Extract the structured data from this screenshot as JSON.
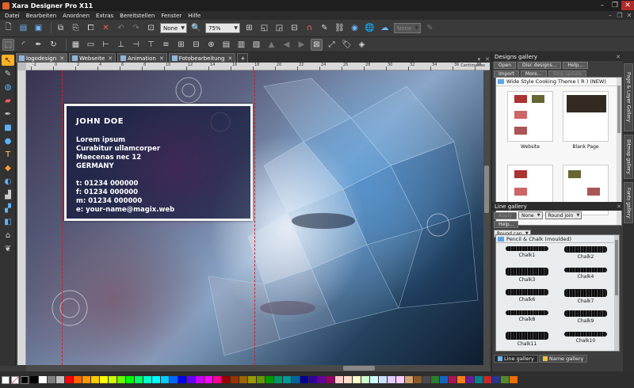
{
  "app": {
    "title": "Xara Designer Pro X11"
  },
  "window_controls": {
    "minimize": "–",
    "restore": "❐",
    "close": "✕"
  },
  "menu": [
    "Datei",
    "Bearbeiten",
    "Anordnen",
    "Extras",
    "Bereitstellen",
    "Fenster",
    "Hilfe"
  ],
  "doc_controls": [
    "–",
    "❐",
    "✕"
  ],
  "toolbar": {
    "line_width_value": "None",
    "zoom_value": "75%",
    "blend_value": "None"
  },
  "doc_tabs": [
    {
      "label": "logodesign",
      "active": true
    },
    {
      "label": "Webseite",
      "active": false
    },
    {
      "label": "Animation",
      "active": false
    },
    {
      "label": "Fotobearbeitung",
      "active": false
    }
  ],
  "ruler": {
    "units": "Centimetres",
    "labels": [
      "-2",
      "0",
      "2",
      "4",
      "6",
      "8",
      "10",
      "12",
      "14",
      "16",
      "18",
      "20",
      "22",
      "24",
      "26",
      "28",
      "30",
      "32",
      "34",
      "36",
      "38"
    ]
  },
  "business_card": {
    "name": "JOHN DOE",
    "address": [
      "Lorem ipsum",
      "Curabitur ullamcorper",
      "Maecenas nec 12",
      "GERMANY"
    ],
    "contacts": [
      "t: 01234 000000",
      "f: 01234 000000",
      "m: 01234 000000",
      "e: your-name@magix.web"
    ]
  },
  "designs_gallery": {
    "title": "Designs gallery",
    "buttons_row1": [
      "Open",
      "Disc designs...",
      "Help..."
    ],
    "buttons_row2": [
      "Import",
      "More...",
      "Stop update"
    ],
    "folder": "Wide Style Cooking Theme ( R ) (NEW)",
    "items": [
      "Website",
      "Blank Page"
    ]
  },
  "line_gallery": {
    "title": "Line gallery",
    "apply_label": "Apply",
    "help_label": "Help...",
    "dash_value": "None",
    "join_value": "Round join",
    "cap_value": "Round cap",
    "folder": "Pencil & Chalk (moulded)",
    "items": [
      "Chalk1",
      "Chalk2",
      "Chalk3",
      "Chalk4",
      "Chalk6",
      "Chalk7",
      "Chalk8",
      "Chalk9",
      "Chalk11",
      "Chalk10"
    ]
  },
  "gallery_tabs": [
    "Line gallery",
    "Name gallery"
  ],
  "side_tabs": [
    "Page & Layer Gallery",
    "Bitmap gallery",
    "Fonts gallery"
  ],
  "palette": [
    "#000000",
    "#ffffff",
    "#7f7f7f",
    "#c0c0c0",
    "#ff0000",
    "#ff6600",
    "#ff9900",
    "#ffcc00",
    "#ffff00",
    "#ccff00",
    "#66ff00",
    "#00ff00",
    "#00ff66",
    "#00ffcc",
    "#00ffff",
    "#00ccff",
    "#0066ff",
    "#0000ff",
    "#6600ff",
    "#cc00ff",
    "#ff00ff",
    "#ff0099",
    "#990000",
    "#993300",
    "#996600",
    "#999900",
    "#669900",
    "#009900",
    "#009966",
    "#009999",
    "#006699",
    "#000099",
    "#330099",
    "#660099",
    "#990066",
    "#ffcccc",
    "#ffe0cc",
    "#ffffcc",
    "#ccffcc",
    "#ccffff",
    "#cce0ff",
    "#e0ccff",
    "#ffccff",
    "#d4a373",
    "#8b5a2b",
    "#4a4a4a",
    "#2e7d32",
    "#1565c0",
    "#ad1457",
    "#f57f17",
    "#6a1b9a",
    "#00838f",
    "#c62828",
    "#283593",
    "#558b2f",
    "#ef6c00"
  ]
}
